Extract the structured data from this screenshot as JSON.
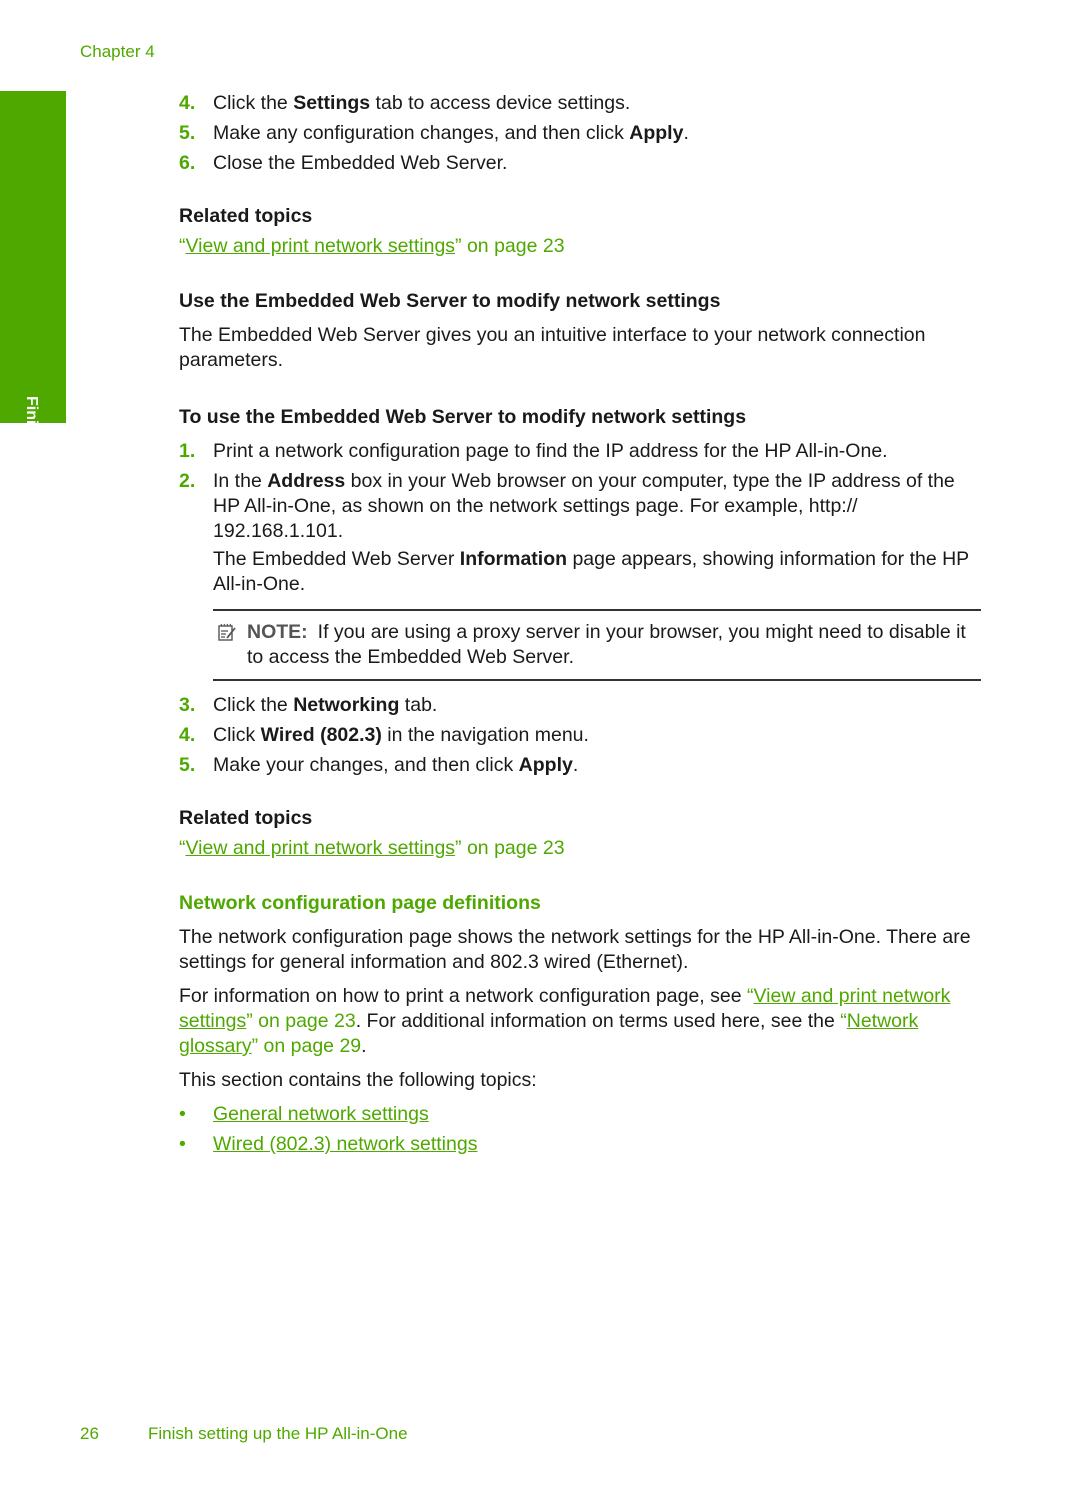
{
  "header": {
    "chapter": "Chapter 4"
  },
  "side_tab": {
    "label": "Finish setup"
  },
  "steps_top": [
    {
      "num": "4.",
      "pre": "Click the ",
      "bold": "Settings",
      "post": " tab to access device settings."
    },
    {
      "num": "5.",
      "pre": "Make any configuration changes, and then click ",
      "bold": "Apply",
      "post": "."
    },
    {
      "num": "6.",
      "pre": "Close the Embedded Web Server.",
      "bold": "",
      "post": ""
    }
  ],
  "related1": {
    "heading": "Related topics",
    "open_quote": "“",
    "link": "View and print network settings",
    "suffix": "” on page 23"
  },
  "ews_section": {
    "heading": "Use the Embedded Web Server to modify network settings",
    "intro": "The Embedded Web Server gives you an intuitive interface to your network connection parameters.",
    "proc_heading": "To use the Embedded Web Server to modify network settings",
    "steps": [
      {
        "num": "1.",
        "text": "Print a network configuration page to find the IP address for the HP All-in-One."
      },
      {
        "num": "2.",
        "pre": "In the ",
        "bold": "Address",
        "post": " box in your Web browser on your computer, type the IP address of the HP All-in-One, as shown on the network settings page. For example, http:// 192.168.1.101.",
        "sub_pre": "The Embedded Web Server ",
        "sub_bold": "Information",
        "sub_post": " page appears, showing information for the HP All-in-One."
      }
    ],
    "note": {
      "label": "NOTE:",
      "text": "If you are using a proxy server in your browser, you might need to disable it to access the Embedded Web Server."
    },
    "steps2": [
      {
        "num": "3.",
        "pre": "Click the ",
        "bold": "Networking",
        "post": " tab."
      },
      {
        "num": "4.",
        "pre": "Click ",
        "bold": "Wired (802.3)",
        "post": " in the navigation menu."
      },
      {
        "num": "5.",
        "pre": "Make your changes, and then click ",
        "bold": "Apply",
        "post": "."
      }
    ]
  },
  "related2": {
    "heading": "Related topics",
    "open_quote": "“",
    "link": "View and print network settings",
    "suffix": "” on page 23"
  },
  "definitions": {
    "heading": "Network configuration page definitions",
    "para1": "The network configuration page shows the network settings for the HP All-in-One. There are settings for general information and 802.3 wired (Ethernet).",
    "para2_pre": "For information on how to print a network configuration page, see ",
    "para2_q1": "“",
    "para2_link1": "View and print network settings",
    "para2_s1": "” on page 23",
    "para2_mid": ". For additional information on terms used here, see the ",
    "para2_q2": "“",
    "para2_link2": "Network glossary",
    "para2_s2": "” on page 29",
    "para2_end": ".",
    "para3": "This section contains the following topics:",
    "topics": [
      "General network settings",
      "Wired (802.3) network settings"
    ],
    "bullet_char": "•"
  },
  "footer": {
    "page_number": "26",
    "title": "Finish setting up the HP All-in-One"
  }
}
